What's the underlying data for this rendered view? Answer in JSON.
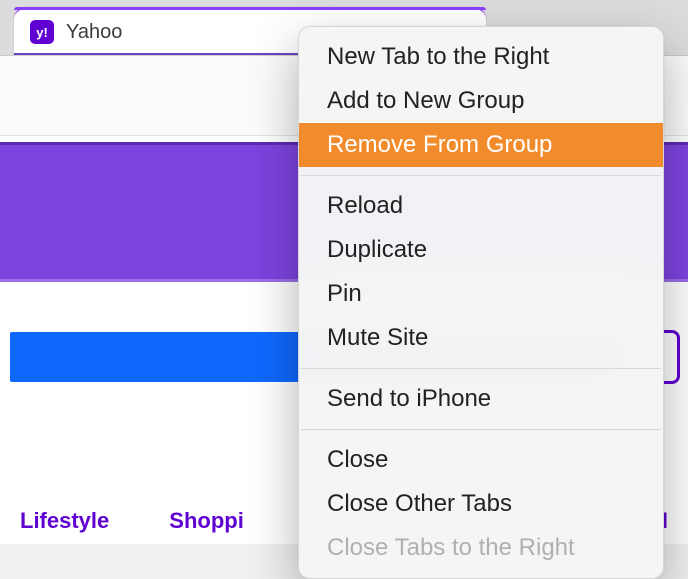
{
  "tab": {
    "favicon_letter": "y!",
    "title": "Yahoo",
    "close_glyph": "×"
  },
  "page_nav": {
    "items": [
      {
        "label": "Lifestyle"
      },
      {
        "label": "Shoppi"
      },
      {
        "label": "M"
      }
    ]
  },
  "context_menu": {
    "groups": [
      [
        {
          "label": "New Tab to the Right",
          "interactable": true,
          "highlight": false,
          "disabled": false
        },
        {
          "label": "Add to New Group",
          "interactable": true,
          "highlight": false,
          "disabled": false
        },
        {
          "label": "Remove From Group",
          "interactable": true,
          "highlight": true,
          "disabled": false
        }
      ],
      [
        {
          "label": "Reload",
          "interactable": true,
          "highlight": false,
          "disabled": false
        },
        {
          "label": "Duplicate",
          "interactable": true,
          "highlight": false,
          "disabled": false
        },
        {
          "label": "Pin",
          "interactable": true,
          "highlight": false,
          "disabled": false
        },
        {
          "label": "Mute Site",
          "interactable": true,
          "highlight": false,
          "disabled": false
        }
      ],
      [
        {
          "label": "Send to iPhone",
          "interactable": true,
          "highlight": false,
          "disabled": false
        }
      ],
      [
        {
          "label": "Close",
          "interactable": true,
          "highlight": false,
          "disabled": false
        },
        {
          "label": "Close Other Tabs",
          "interactable": true,
          "highlight": false,
          "disabled": false
        },
        {
          "label": "Close Tabs to the Right",
          "interactable": false,
          "highlight": false,
          "disabled": true
        }
      ]
    ]
  },
  "colors": {
    "accent_purple": "#5f01d1",
    "band_purple": "#7e44e0",
    "blue_bar": "#0f69ff",
    "menu_highlight": "#f28b2b"
  }
}
